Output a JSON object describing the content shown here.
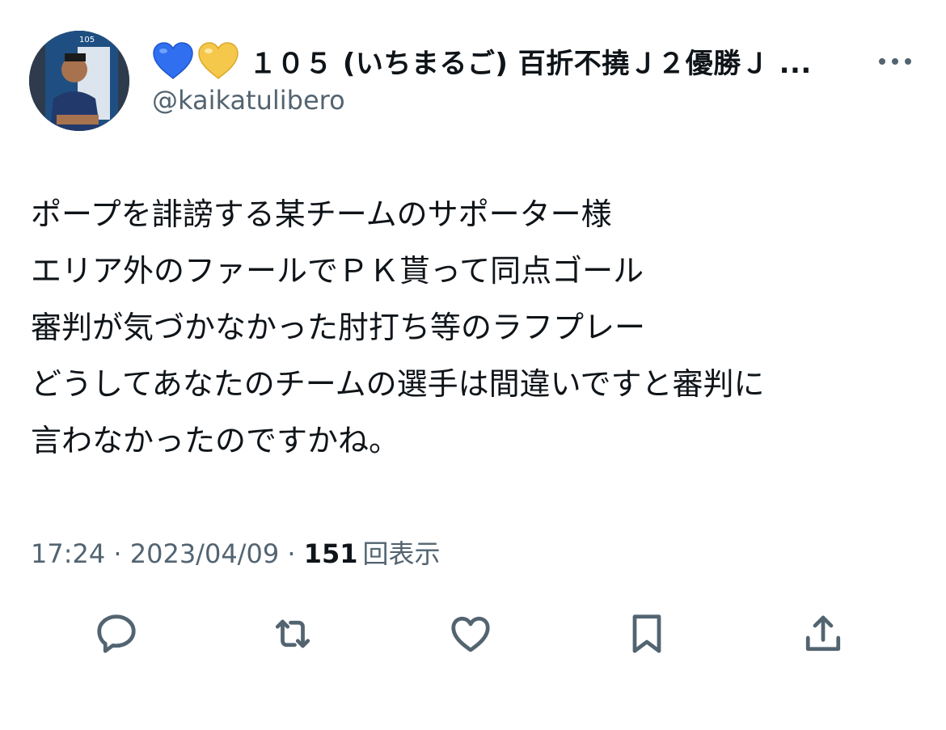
{
  "author": {
    "display_name": "１０５ (いちまるご) 百折不撓Ｊ２優勝Ｊ ...",
    "handle": "@kaikatulibero",
    "avatar_icon": "profile-photo",
    "avatar_text": "105",
    "badges": [
      "blue-heart-icon",
      "yellow-heart-icon"
    ]
  },
  "tweet": {
    "lines": [
      "ポープを誹謗する某チームのサポーター様",
      "エリア外のファールでＰＫ貰って同点ゴール",
      "審判が気づかなかった肘打ち等のラフプレー",
      "どうしてあなたのチームの選手は間違いですと審判に",
      "言わなかったのですかね。"
    ]
  },
  "meta": {
    "time": "17:24",
    "separator": " · ",
    "date": "2023/04/09",
    "separator2": " · ",
    "views_count": "151",
    "views_label": "回表示"
  },
  "actions": [
    "reply-icon",
    "retweet-icon",
    "like-icon",
    "bookmark-icon",
    "share-icon"
  ],
  "colors": {
    "text": "#0f1419",
    "secondary": "#536471",
    "background": "#ffffff",
    "blue_heart": "#2f6ff0",
    "yellow_heart": "#f5c84c"
  }
}
